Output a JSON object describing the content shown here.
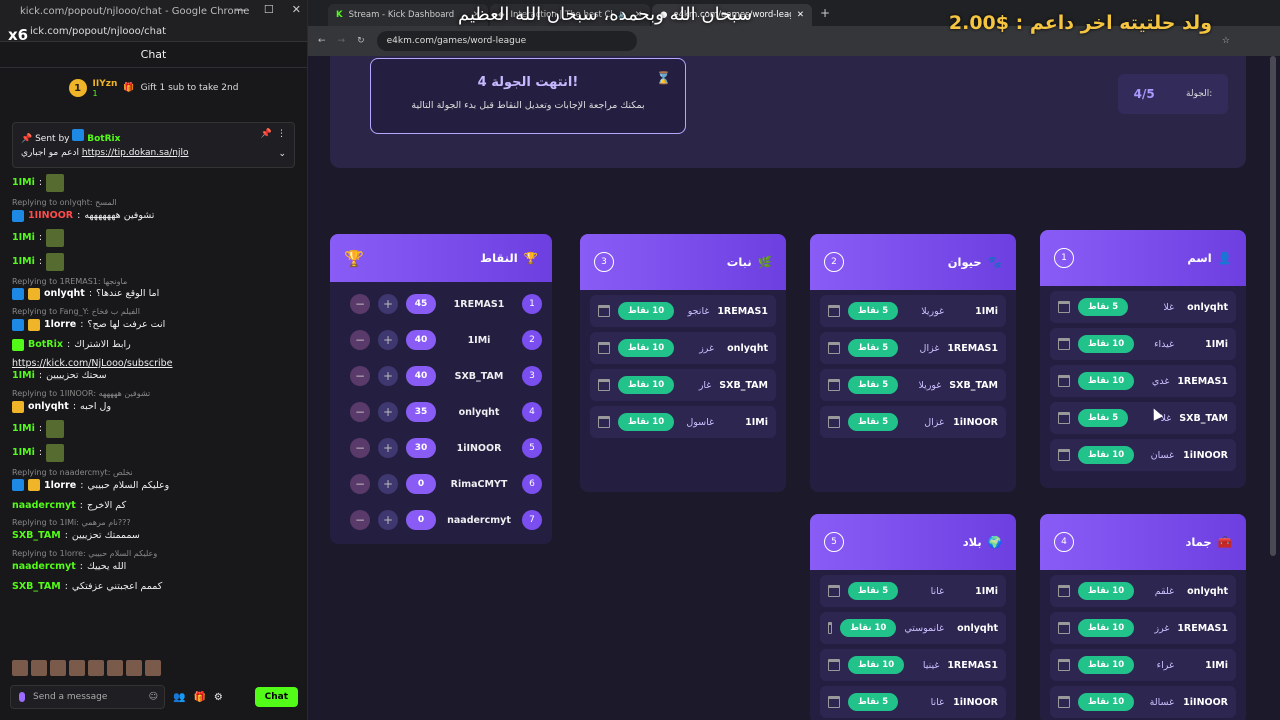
{
  "chat_window": {
    "title": "kick.com/popout/njlooo/chat - Google Chrome",
    "url": "ick.com/popout/njlooo/chat",
    "overlay_tag": "x6",
    "header": "Chat",
    "top_gifter": {
      "rank": "1",
      "name": "IIYzn",
      "count": "1",
      "text": "Gift 1 sub to take 2nd"
    },
    "pinned": {
      "sent_by": "Sent by",
      "bot": "BotRix",
      "text": "ادعم مو اجباري",
      "link": "https://tip.dokan.sa/njlo"
    },
    "messages": [
      {
        "user": "1IMi",
        "text": "",
        "reply": ""
      },
      {
        "user": "1IINOOR",
        "text": "تشوفين هههههههه",
        "reply": "Replying to onlyqht: المسح"
      },
      {
        "user": "1IMi",
        "text": "",
        "reply": ""
      },
      {
        "user": "1IMi",
        "text": "",
        "reply": ""
      },
      {
        "user": "onlyqht",
        "text": "اما الوقع عندها؟",
        "reply": "Replying to 1REMAS1: ماونجها"
      },
      {
        "user": "1lorre",
        "text": "انت عرفت لها صح؟",
        "reply": "Replying to Fang_Y: الفيلم ب فخاخ"
      },
      {
        "user": "BotRix",
        "text": "رابط الاشتراك",
        "link": "https://kick.com/NjLooo/subscribe",
        "reply": ""
      },
      {
        "user": "1IMi",
        "text": "سحتك تحزيييين",
        "reply": ""
      },
      {
        "user": "onlyqht",
        "text": "ول احبه",
        "reply": "Replying to 1IINOOR: تشوفين هههههه"
      },
      {
        "user": "1IMi",
        "text": "",
        "reply": ""
      },
      {
        "user": "1IMi",
        "text": "",
        "reply": ""
      },
      {
        "user": "1lorre",
        "text": "وعليكم السلام حبيبي",
        "reply": "Replying to naadercmyt: نخلص"
      },
      {
        "user": "naadercmyt",
        "text": "كم الاخرج",
        "reply": ""
      },
      {
        "user": "SXB_TAM",
        "text": "سمممتك تحزييين",
        "reply": "Replying to 1IMi: نام مرهمي???"
      },
      {
        "user": "naadercmyt",
        "text": "الله يحييك",
        "reply": "Replying to 1lorre: وعليكم السلام حبيبي"
      },
      {
        "user": "SXB_TAM",
        "text": "كممم اعجبتني عزفتكي",
        "reply": ""
      }
    ],
    "input_placeholder": "Send a message",
    "chat_button": "Chat"
  },
  "browser": {
    "tabs": [
      {
        "label": "Stream - Kick Dashboard"
      },
      {
        "label": "Interaction | The best Chatt"
      },
      {
        "label": "e4km.com/games/word-league"
      }
    ],
    "url": "e4km.com/games/word-league",
    "overlay_text": "سبحان الله وبحمده، سبحان الله العظيم",
    "donation_text": "ولد حلتيته اخر داعم : $2.00"
  },
  "game": {
    "round_end": {
      "title": "انتهت الجولة 4!",
      "subtitle": "بمكنك مراجعة الإجابات وتعديل النقاط قبل بدء الجولة التالية"
    },
    "round_label": "الجولة:",
    "round_value": "4/5",
    "scoreboard": {
      "title": "النقاط",
      "rows": [
        {
          "rank": "1",
          "name": "1REMAS1",
          "score": "45"
        },
        {
          "rank": "2",
          "name": "1IMi",
          "score": "40"
        },
        {
          "rank": "3",
          "name": "SXB_TAM",
          "score": "40"
        },
        {
          "rank": "4",
          "name": "onlyqht",
          "score": "35"
        },
        {
          "rank": "5",
          "name": "1iINOOR",
          "score": "30"
        },
        {
          "rank": "6",
          "name": "RimaCMYT",
          "score": "0"
        },
        {
          "rank": "7",
          "name": "naadercmyt",
          "score": "0"
        }
      ]
    },
    "categories": [
      {
        "num": "1",
        "title": "اسم",
        "rows": [
          {
            "name": "onlyqht",
            "answer": "غلا",
            "points": "5 نقاط"
          },
          {
            "name": "1IMi",
            "answer": "غيداء",
            "points": "10 نقاط"
          },
          {
            "name": "1REMAS1",
            "answer": "غدي",
            "points": "10 نقاط"
          },
          {
            "name": "SXB_TAM",
            "answer": "غلا",
            "points": "5 نقاط"
          },
          {
            "name": "1iINOOR",
            "answer": "غسان",
            "points": "10 نقاط"
          }
        ]
      },
      {
        "num": "2",
        "title": "حيوان",
        "rows": [
          {
            "name": "1IMi",
            "answer": "غوريلا",
            "points": "5 نقاط"
          },
          {
            "name": "1REMAS1",
            "answer": "غزال",
            "points": "5 نقاط"
          },
          {
            "name": "SXB_TAM",
            "answer": "غوريلا",
            "points": "5 نقاط"
          },
          {
            "name": "1iINOOR",
            "answer": "غزال",
            "points": "5 نقاط"
          }
        ]
      },
      {
        "num": "3",
        "title": "نبات",
        "rows": [
          {
            "name": "1REMAS1",
            "answer": "غانجو",
            "points": "10 نقاط"
          },
          {
            "name": "onlyqht",
            "answer": "غرز",
            "points": "10 نقاط"
          },
          {
            "name": "SXB_TAM",
            "answer": "غار",
            "points": "10 نقاط"
          },
          {
            "name": "1IMi",
            "answer": "غاسول",
            "points": "10 نقاط"
          }
        ]
      },
      {
        "num": "4",
        "title": "جماد",
        "rows": [
          {
            "name": "onlyqht",
            "answer": "غلقم",
            "points": "10 نقاط"
          },
          {
            "name": "1REMAS1",
            "answer": "غرز",
            "points": "10 نقاط"
          },
          {
            "name": "1IMi",
            "answer": "غراء",
            "points": "10 نقاط"
          },
          {
            "name": "1iINOOR",
            "answer": "غسالة",
            "points": "10 نقاط"
          }
        ]
      },
      {
        "num": "5",
        "title": "بلاد",
        "rows": [
          {
            "name": "1IMi",
            "answer": "غانا",
            "points": "5 نقاط"
          },
          {
            "name": "onlyqht",
            "answer": "غانموستي",
            "points": "10 نقاط"
          },
          {
            "name": "1REMAS1",
            "answer": "غينيا",
            "points": "10 نقاط"
          },
          {
            "name": "1iINOOR",
            "answer": "غانا",
            "points": "5 نقاط"
          }
        ]
      }
    ]
  }
}
